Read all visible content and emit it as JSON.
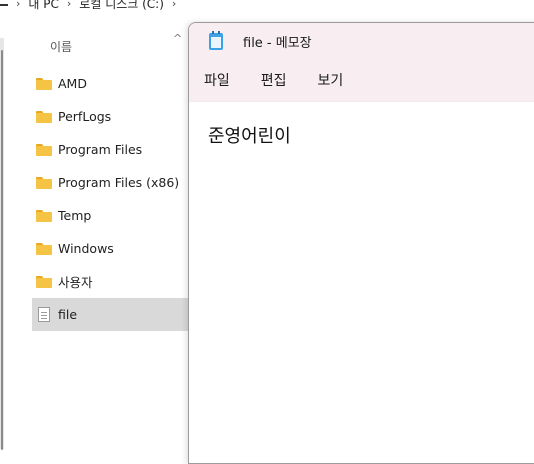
{
  "breadcrumb": [
    "내 PC",
    "로컬 디스크 (C:)"
  ],
  "explorer": {
    "column_header": "이름",
    "items": [
      {
        "name": "AMD",
        "type": "folder"
      },
      {
        "name": "PerfLogs",
        "type": "folder"
      },
      {
        "name": "Program Files",
        "type": "folder"
      },
      {
        "name": "Program Files (x86)",
        "type": "folder"
      },
      {
        "name": "Temp",
        "type": "folder"
      },
      {
        "name": "Windows",
        "type": "folder"
      },
      {
        "name": "사용자",
        "type": "folder"
      },
      {
        "name": "file",
        "type": "text-file",
        "selected": true
      }
    ]
  },
  "notepad": {
    "title": "file - 메모장",
    "menu": [
      "파일",
      "편집",
      "보기"
    ],
    "content": "준영어린이"
  },
  "colors": {
    "notepad_titlebar": "#f8eef1",
    "selection": "#d9d9d9",
    "folder": "#f6c444",
    "notepad_icon": "#3da1e6"
  }
}
